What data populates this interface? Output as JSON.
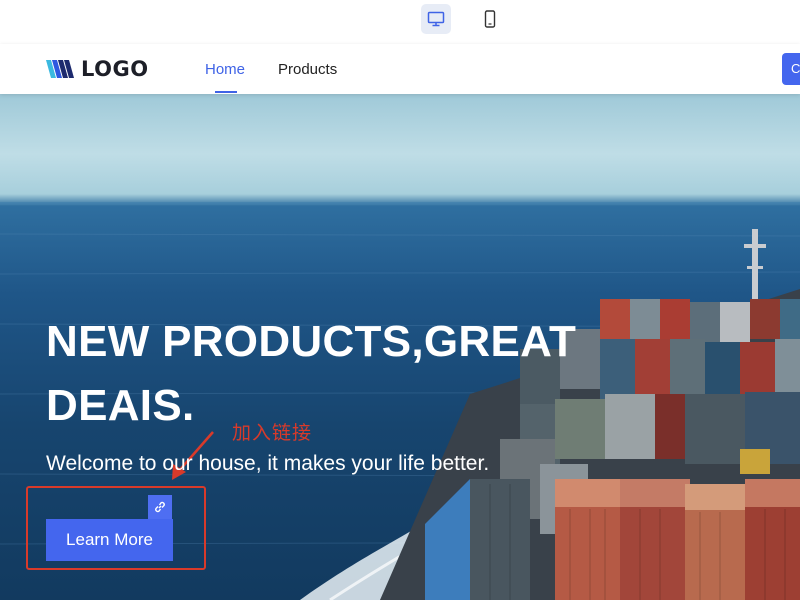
{
  "devices": {
    "desktop": {
      "icon": "monitor-icon",
      "selected": true
    },
    "mobile": {
      "icon": "mobile-icon",
      "selected": false
    }
  },
  "header": {
    "logo_text": "LOGO",
    "nav": [
      {
        "label": "Home",
        "active": true
      },
      {
        "label": "Products",
        "active": false
      }
    ],
    "cta_label": "C",
    "accent_color": "#3f63e6"
  },
  "hero": {
    "title": "NEW PRODUCTS,GREAT DEAIS.",
    "subtitle": "Welcome to our house, it makes your life better.",
    "button_label": "Learn More",
    "button_color": "#4466ee",
    "link_icon": "link-icon"
  },
  "annotation": {
    "text": "加入链接",
    "color": "#d93a2a"
  }
}
